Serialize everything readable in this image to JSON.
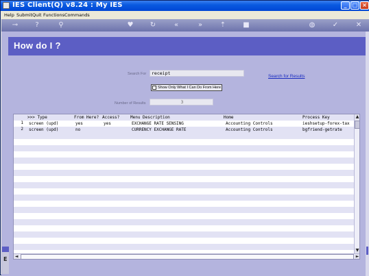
{
  "window": {
    "title": "IES Client(Q) v8.24 : My IES"
  },
  "menubar": {
    "items": [
      "Help",
      "Submit",
      "Quit",
      "Functions",
      "Commands"
    ]
  },
  "toolbar": {
    "icons": [
      "key-icon",
      "help-icon",
      "search-icon",
      "heart-icon",
      "refresh-icon",
      "back-icon",
      "forward-icon",
      "upload-icon",
      "stop-icon",
      "save-icon",
      "check-icon",
      "close-icon"
    ]
  },
  "page": {
    "title": "How do I ?"
  },
  "search": {
    "label": "Search For",
    "value": "receipt",
    "results_link": "Search for Results",
    "checkbox_label": "Show Only What I Can Do From Here",
    "checkbox_checked": false,
    "results_label": "Number of Results",
    "results_count": "3"
  },
  "grid": {
    "columns": [
      ">>> Type",
      "From Here?",
      "Access?",
      "Menu Description",
      "Home",
      "Process Key"
    ],
    "rows": [
      {
        "num": "1",
        "type": "screen (upd)",
        "from_here": "yes",
        "access": "yes",
        "description": "EXCHANGE RATE SENSING",
        "home": "Accounting Controls",
        "process_key": "ieshsetup-forex-tax"
      },
      {
        "num": "2",
        "type": "screen (upd)",
        "from_here": "no",
        "access": "",
        "description": "CURRENCY EXCHANGE RATE",
        "home": "Accounting Controls",
        "process_key": "bgfriend-getrate"
      }
    ]
  },
  "side": {
    "label": "E"
  }
}
